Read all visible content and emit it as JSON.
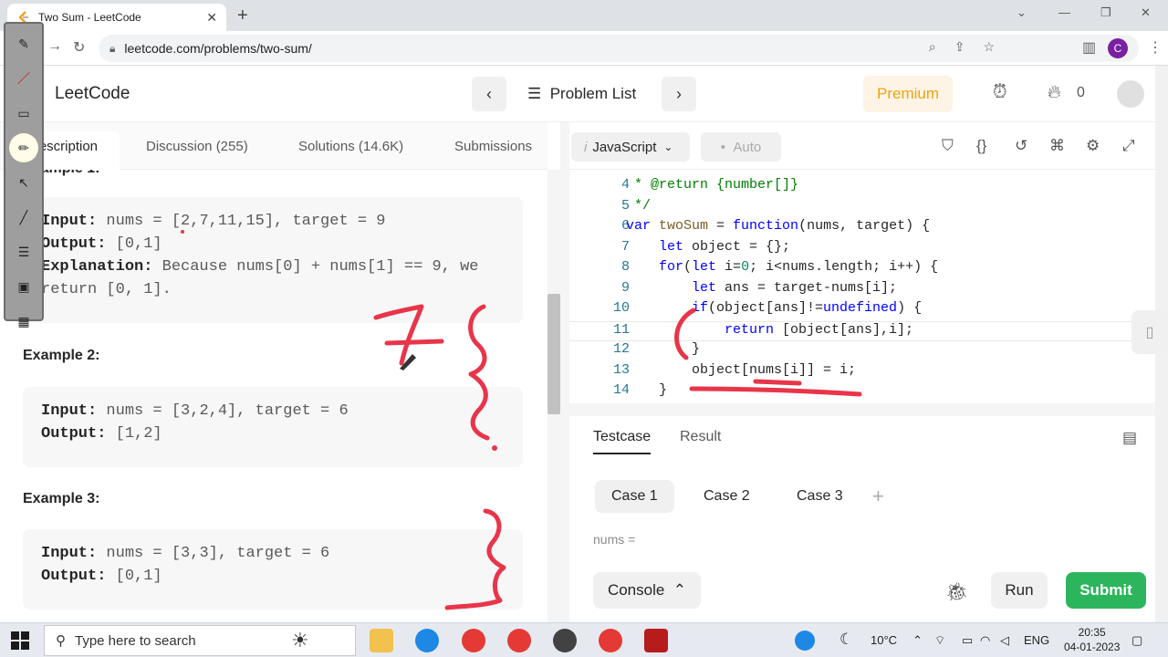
{
  "browser": {
    "tab_title": "Two Sum - LeetCode",
    "url": "leetcode.com/problems/two-sum/",
    "profile_letter": "C"
  },
  "header": {
    "logo": "LeetCode",
    "problem_list": "Problem List",
    "premium": "Premium",
    "streak": "0"
  },
  "left_tabs": {
    "description": "Description",
    "discussion": "Discussion (255)",
    "solutions": "Solutions (14.6K)",
    "submissions": "Submissions"
  },
  "examples": {
    "ex1_heading_partial": "Example 1:",
    "ex1": {
      "input_label": "Input:",
      "input": "nums = [2,7,11,15], target = 9",
      "output_label": "Output:",
      "output": "[0,1]",
      "explanation_label": "Explanation:",
      "explanation_1": "Because nums[0] + nums[1] == 9, we",
      "explanation_2": "return [0, 1]."
    },
    "ex2_heading": "Example 2:",
    "ex2": {
      "input_label": "Input:",
      "input": "nums = [3,2,4], target = 6",
      "output_label": "Output:",
      "output": "[1,2]"
    },
    "ex3_heading": "Example 3:",
    "ex3": {
      "input_label": "Input:",
      "input": "nums = [3,3], target = 6",
      "output_label": "Output:",
      "output": "[0,1]"
    }
  },
  "editor": {
    "language": "JavaScript",
    "mode": "Auto",
    "lines": [
      {
        "n": "4",
        "segments": [
          {
            "t": " * @return ",
            "c": "cm"
          },
          {
            "t": "{number[]}",
            "c": "cm"
          }
        ]
      },
      {
        "n": "5",
        "segments": [
          {
            "t": " */",
            "c": "cm"
          }
        ]
      },
      {
        "n": "6",
        "segments": [
          {
            "t": "var ",
            "c": "kw"
          },
          {
            "t": "twoSum",
            "c": "fn"
          },
          {
            "t": " = ",
            "c": ""
          },
          {
            "t": "function",
            "c": "kw"
          },
          {
            "t": "(nums, target) {",
            "c": ""
          }
        ]
      },
      {
        "n": "7",
        "segments": [
          {
            "t": "    let ",
            "c": "kw"
          },
          {
            "t": "object = {};",
            "c": ""
          }
        ]
      },
      {
        "n": "8",
        "segments": [
          {
            "t": "    for",
            "c": "kw"
          },
          {
            "t": "(",
            "c": ""
          },
          {
            "t": "let ",
            "c": "kw"
          },
          {
            "t": "i=",
            "c": ""
          },
          {
            "t": "0",
            "c": "num"
          },
          {
            "t": "; i<nums.length; i++) {",
            "c": ""
          }
        ]
      },
      {
        "n": "9",
        "segments": [
          {
            "t": "        let ",
            "c": "kw"
          },
          {
            "t": "ans = target-nums[i];",
            "c": ""
          }
        ]
      },
      {
        "n": "10",
        "segments": [
          {
            "t": "        if",
            "c": "kw"
          },
          {
            "t": "(object[ans]!=",
            "c": ""
          },
          {
            "t": "undefined",
            "c": "kw"
          },
          {
            "t": ") {",
            "c": ""
          }
        ]
      },
      {
        "n": "11",
        "segments": [
          {
            "t": "            return ",
            "c": "kw"
          },
          {
            "t": "[object[ans],i];",
            "c": ""
          }
        ]
      },
      {
        "n": "12",
        "segments": [
          {
            "t": "        }",
            "c": ""
          }
        ]
      },
      {
        "n": "13",
        "segments": [
          {
            "t": "        object[nums[i]] = i;",
            "c": ""
          }
        ]
      },
      {
        "n": "14",
        "segments": [
          {
            "t": "    }",
            "c": ""
          }
        ]
      }
    ]
  },
  "testpane": {
    "testcase_tab": "Testcase",
    "result_tab": "Result",
    "cases": [
      "Case 1",
      "Case 2",
      "Case 3"
    ],
    "nums_label": "nums =",
    "console": "Console",
    "run": "Run",
    "submit": "Submit"
  },
  "taskbar": {
    "search_placeholder": "Type here to search",
    "temperature": "10°C",
    "language": "ENG",
    "time": "20:35",
    "date": "04-01-2023"
  },
  "colors": {
    "submit_green": "#2db55d",
    "premium_orange": "#f0a30a",
    "annotation_red": "#e8354a"
  }
}
